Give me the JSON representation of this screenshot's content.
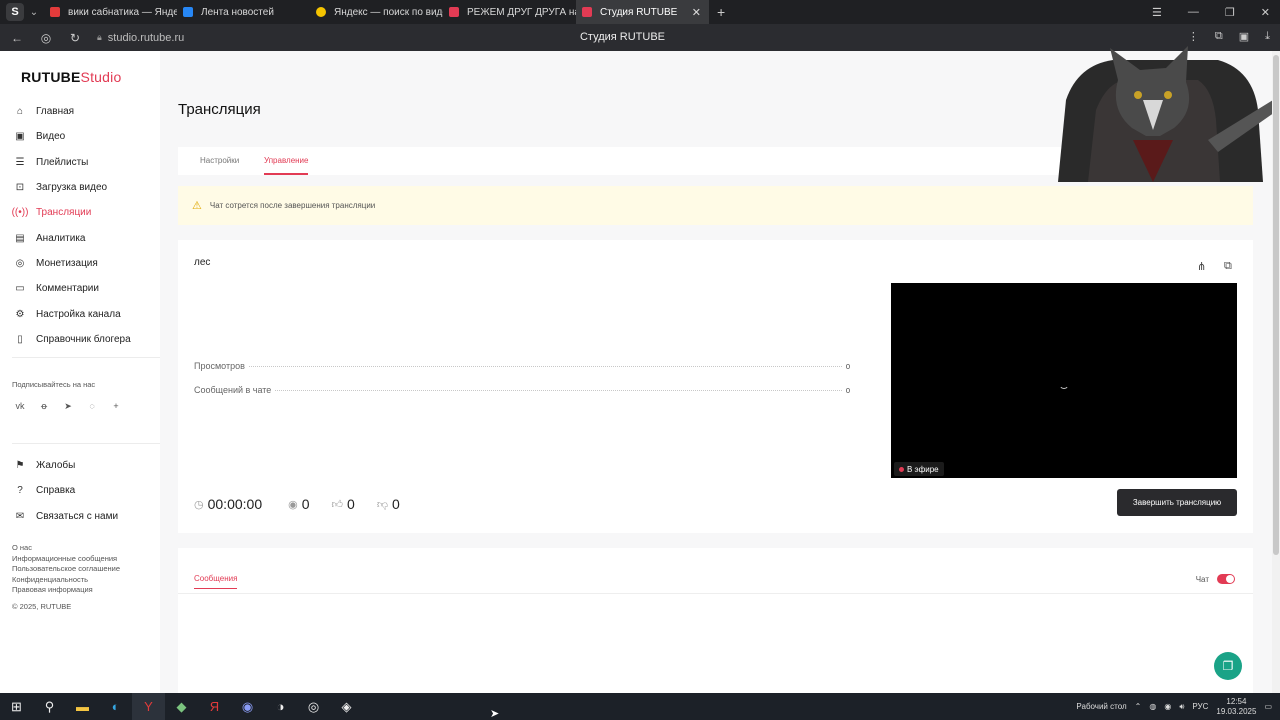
{
  "browser": {
    "tabs": [
      {
        "label": "вики сабнатика — Яндекс",
        "fav_color": "#e23b3b"
      },
      {
        "label": "Лента новостей",
        "fav_color": "#2787f5"
      },
      {
        "label": "Яндекс — поиск по видео",
        "fav_color": "#f5c400"
      },
      {
        "label": "РЕЖЕМ ДРУГ ДРУГА на",
        "fav_color": "#e23b54"
      },
      {
        "label": "Студия RUTUBE",
        "fav_color": "#e23b54"
      }
    ],
    "url": "studio.rutube.ru",
    "page_title": "Студия RUTUBE"
  },
  "sidebar": {
    "logo": "RUTUBE",
    "logo_suffix": "Studio",
    "items": [
      {
        "label": "Главная",
        "icon": "home-icon"
      },
      {
        "label": "Видео",
        "icon": "video-icon"
      },
      {
        "label": "Плейлисты",
        "icon": "playlist-icon"
      },
      {
        "label": "Загрузка видео",
        "icon": "upload-icon"
      },
      {
        "label": "Трансляции",
        "icon": "broadcast-icon"
      },
      {
        "label": "Аналитика",
        "icon": "analytics-icon"
      },
      {
        "label": "Монетизация",
        "icon": "monetization-icon"
      },
      {
        "label": "Комментарии",
        "icon": "comments-icon"
      },
      {
        "label": "Настройка канала",
        "icon": "gear-icon"
      },
      {
        "label": "Справочник блогера",
        "icon": "book-icon"
      }
    ],
    "subscribe_label": "Подписывайтесь на нас",
    "secondary": [
      {
        "label": "Жалобы",
        "icon": "flag-icon"
      },
      {
        "label": "Справка",
        "icon": "help-icon"
      },
      {
        "label": "Связаться с нами",
        "icon": "mail-icon"
      }
    ],
    "footer": [
      "О нас",
      "Информационные сообщения",
      "Пользовательское соглашение",
      "Конфиденциальность",
      "Правовая информация",
      "© 2025, RUTUBE"
    ]
  },
  "main": {
    "title": "Трансляция",
    "tabs": [
      "Настройки",
      "Управление"
    ],
    "warning": "Чат сотрется после завершения трансляции",
    "stream": {
      "name": "лес",
      "stats": [
        {
          "label": "Просмотров",
          "value": "0"
        },
        {
          "label": "Сообщений в чате",
          "value": "0"
        }
      ],
      "duration": "00:00:00",
      "viewers": "0",
      "likes": "0",
      "dislikes": "0",
      "live_label": "В эфире",
      "end_button": "Завершить трансляцию"
    },
    "chat": {
      "tab_label": "Сообщения",
      "toggle_label": "Чат",
      "toggle_on": true
    }
  },
  "taskbar": {
    "desktop_label": "Рабочий стол",
    "lang": "РУС",
    "time": "12:54",
    "date": "19.03.2025"
  },
  "colors": {
    "accent": "#e23b54",
    "warning_bg": "#fffbe6"
  }
}
